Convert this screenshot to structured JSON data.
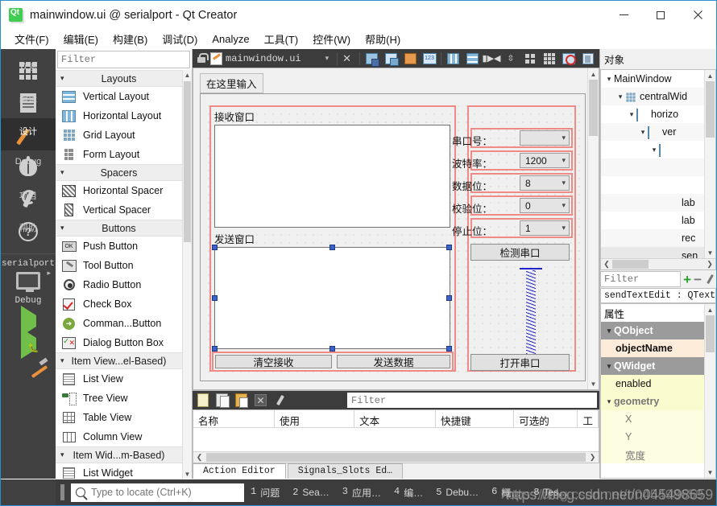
{
  "window": {
    "title": "mainwindow.ui @ serialport - Qt Creator",
    "logo_icon": "qt-logo-icon",
    "minimize_label": "—",
    "maximize_label": "□",
    "close_label": "✕"
  },
  "menubar": [
    {
      "label": "文件(F)"
    },
    {
      "label": "编辑(E)"
    },
    {
      "label": "构建(B)"
    },
    {
      "label": "调试(D)"
    },
    {
      "label": "Analyze"
    },
    {
      "label": "工具(T)"
    },
    {
      "label": "控件(W)"
    },
    {
      "label": "帮助(H)"
    }
  ],
  "modebar": {
    "modes": [
      {
        "label": "欢迎",
        "icon": "grid-icon",
        "active": false
      },
      {
        "label": "编辑",
        "icon": "document-icon",
        "active": false
      },
      {
        "label": "设计",
        "icon": "pencil-icon",
        "active": true
      },
      {
        "label": "Debug",
        "icon": "bug-icon",
        "active": false
      },
      {
        "label": "项目",
        "icon": "wrench-icon",
        "active": false
      },
      {
        "label": "帮助",
        "icon": "question-icon",
        "active": false
      }
    ],
    "kit": {
      "project": "serialport",
      "build_config": "Debug",
      "icon": "monitor-icon"
    },
    "run_label": "",
    "actions": [
      "run-icon",
      "debug-run-icon",
      "build-hammer-icon"
    ]
  },
  "widgetbox": {
    "filter_placeholder": "Filter",
    "groups": [
      {
        "title": "Layouts",
        "items": [
          {
            "label": "Vertical Layout",
            "icon": "vertical-layout-icon"
          },
          {
            "label": "Horizontal Layout",
            "icon": "horizontal-layout-icon"
          },
          {
            "label": "Grid Layout",
            "icon": "grid-layout-icon"
          },
          {
            "label": "Form Layout",
            "icon": "form-layout-icon"
          }
        ]
      },
      {
        "title": "Spacers",
        "items": [
          {
            "label": "Horizontal Spacer",
            "icon": "horizontal-spacer-icon"
          },
          {
            "label": "Vertical Spacer",
            "icon": "vertical-spacer-icon"
          }
        ]
      },
      {
        "title": "Buttons",
        "items": [
          {
            "label": "Push Button",
            "icon": "push-button-icon"
          },
          {
            "label": "Tool Button",
            "icon": "tool-button-icon"
          },
          {
            "label": "Radio Button",
            "icon": "radio-button-icon"
          },
          {
            "label": "Check Box",
            "icon": "check-box-icon"
          },
          {
            "label": "Comman...Button",
            "icon": "command-link-button-icon"
          },
          {
            "label": "Dialog Button Box",
            "icon": "dialog-button-box-icon"
          }
        ]
      },
      {
        "title": "Item View...el-Based)",
        "items": [
          {
            "label": "List View",
            "icon": "list-view-icon"
          },
          {
            "label": "Tree View",
            "icon": "tree-view-icon"
          },
          {
            "label": "Table View",
            "icon": "table-view-icon"
          },
          {
            "label": "Column View",
            "icon": "column-view-icon"
          }
        ]
      },
      {
        "title": "Item Wid...m-Based)",
        "items": [
          {
            "label": "List Widget",
            "icon": "list-widget-icon"
          }
        ]
      }
    ]
  },
  "editor_toolbar": {
    "lock_icon": "unlocked-icon",
    "file_icon": "ui-file-icon",
    "filename": "mainwindow.ui",
    "dropdown_icon": "chevron-down-icon",
    "close_icon": "close-icon",
    "tools": [
      "break-layout-icon",
      "adjust-size-icon",
      "edit-signals-icon",
      "tab-order-icon",
      "layout-horizontally-icon",
      "layout-vertically-icon",
      "layout-splitter-h-icon",
      "layout-splitter-v-icon",
      "layout-form-icon",
      "layout-grid-icon",
      "break-layout-remove-icon",
      "preview-icon"
    ]
  },
  "designer": {
    "menu_placeholder": "在这里输入",
    "receive_group_label": "接收窗口",
    "send_group_label": "发送窗口",
    "fields": [
      {
        "label": "串口号：",
        "value": ""
      },
      {
        "label": "波特率：",
        "value": "1200"
      },
      {
        "label": "数据位：",
        "value": "8"
      },
      {
        "label": "校验位：",
        "value": "0"
      },
      {
        "label": "停止位：",
        "value": "1"
      }
    ],
    "buttons": {
      "detect_port": "检测串口",
      "open_port": "打开串口",
      "clear_receive": "清空接收",
      "send_data": "发送数据"
    },
    "spacer_icon": "vertical-spacer-item"
  },
  "action_editor": {
    "toolbar_icons": [
      "new-action-icon",
      "copy-icon",
      "paste-icon",
      "delete-icon",
      "configure-icon"
    ],
    "filter_placeholder": "Filter",
    "columns": [
      "名称",
      "使用",
      "文本",
      "快捷键",
      "可选的",
      "工"
    ],
    "rows": [],
    "tabs": [
      {
        "label": "Action Editor",
        "active": true
      },
      {
        "label": "Signals_Slots Ed…",
        "active": false
      }
    ]
  },
  "object_inspector": {
    "title": "对象",
    "rows": [
      {
        "indent": 0,
        "chev": "⌄",
        "icon": "",
        "label": "MainWindow"
      },
      {
        "indent": 1,
        "chev": "⌄",
        "icon": "grid-layout-icon",
        "label": "centralWid"
      },
      {
        "indent": 2,
        "chev": "⌄",
        "icon": "horizontal-layout-icon",
        "label": "horizo"
      },
      {
        "indent": 3,
        "chev": "⌄",
        "icon": "vertical-layout-icon",
        "label": "ver"
      },
      {
        "indent": 4,
        "chev": "⌄",
        "icon": "horizontal-layout-icon",
        "label": ""
      },
      {
        "indent": 5,
        "chev": "",
        "icon": "",
        "label": ""
      },
      {
        "indent": 5,
        "chev": "",
        "icon": "",
        "label": ""
      },
      {
        "indent": 5,
        "chev": "",
        "icon": "",
        "label": "lab"
      },
      {
        "indent": 5,
        "chev": "",
        "icon": "",
        "label": "lab"
      },
      {
        "indent": 5,
        "chev": "",
        "icon": "",
        "label": "rec"
      },
      {
        "indent": 5,
        "chev": "",
        "icon": "",
        "label": "sen"
      }
    ]
  },
  "property_editor": {
    "filter_placeholder": "Filter",
    "add_icon": "plus-icon",
    "remove_icon": "minus-icon",
    "configure_icon": "configure-icon",
    "selected_object": "sendTextEdit : QTextE··",
    "title": "属性",
    "rows": [
      {
        "label": "QObject",
        "type": "group"
      },
      {
        "label": "objectName",
        "type": "orange"
      },
      {
        "label": "QWidget",
        "type": "group"
      },
      {
        "label": "enabled",
        "type": "yellow"
      },
      {
        "label": "geometry",
        "type": "yellow-group"
      },
      {
        "label": "X",
        "type": "yellow2"
      },
      {
        "label": "Y",
        "type": "yellow2"
      },
      {
        "label": "宽度",
        "type": "yellow2"
      }
    ]
  },
  "statusbar": {
    "locator_placeholder": "Type to locate (Ctrl+K)",
    "search_icon": "search-icon",
    "items": [
      {
        "num": "1",
        "label": "问题"
      },
      {
        "num": "2",
        "label": "Sea…"
      },
      {
        "num": "3",
        "label": "应用…"
      },
      {
        "num": "4",
        "label": "编…"
      },
      {
        "num": "5",
        "label": "Debu…"
      },
      {
        "num": "6",
        "label": "概…"
      },
      {
        "num": "8",
        "label": "Tes…"
      }
    ],
    "watermark": "https://blog.csdn.net/n045498659"
  },
  "colors": {
    "accent": "#2c8fd4",
    "mode_bg": "#414141",
    "toolbar_bg": "#3c3c3c",
    "selection_red": "#f08a84",
    "handle_blue": "#3a62c8"
  }
}
